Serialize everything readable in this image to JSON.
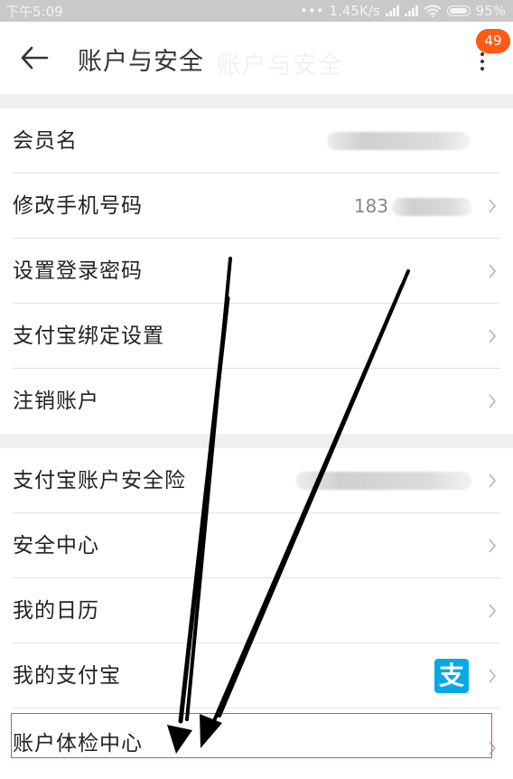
{
  "status_bar": {
    "time": "下午5:09",
    "network_speed": "1.45K/s",
    "battery": "95%"
  },
  "header": {
    "title": "账户与安全",
    "ghost_title": "账户与安全",
    "badge_count": "49"
  },
  "rows": [
    {
      "label": "会员名"
    },
    {
      "label": "修改手机号码",
      "value_prefix": "183"
    },
    {
      "label": "设置登录密码"
    },
    {
      "label": "支付宝绑定设置"
    },
    {
      "label": "注销账户"
    },
    {
      "label": "支付宝账户安全险"
    },
    {
      "label": "安全中心"
    },
    {
      "label": "我的日历"
    },
    {
      "label": "我的支付宝",
      "icon_char": "支"
    },
    {
      "label": "账户体检中心"
    }
  ],
  "colors": {
    "badge": "#ff5a17",
    "alipay_blue": "#06a9e8",
    "highlight_border": "#d9534f",
    "status_bar": "#c9c9c9",
    "section_divider": "#efefef"
  },
  "icons": [
    "back-arrow-icon",
    "more-vertical-icon",
    "chevron-right-icon",
    "alipay-icon",
    "wifi-icon",
    "signal-icon",
    "battery-icon"
  ]
}
